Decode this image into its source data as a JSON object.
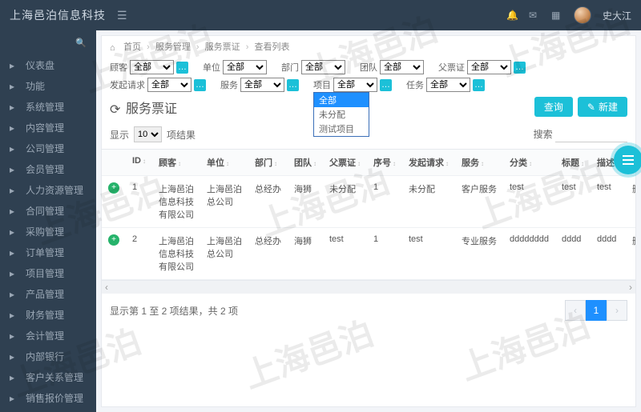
{
  "brand": "上海邑泊信息科技",
  "user": {
    "name": "史大江"
  },
  "watermark": "上海邑泊",
  "sidebar": {
    "items": [
      {
        "icon": "dashboard",
        "label": "仪表盘"
      },
      {
        "icon": "gear",
        "label": "功能"
      },
      {
        "icon": "cog",
        "label": "系统管理"
      },
      {
        "icon": "doc",
        "label": "内容管理"
      },
      {
        "icon": "building",
        "label": "公司管理"
      },
      {
        "icon": "users",
        "label": "会员管理"
      },
      {
        "icon": "hr",
        "label": "人力资源管理"
      },
      {
        "icon": "contract",
        "label": "合同管理"
      },
      {
        "icon": "cart",
        "label": "采购管理"
      },
      {
        "icon": "order",
        "label": "订单管理"
      },
      {
        "icon": "project",
        "label": "项目管理"
      },
      {
        "icon": "product",
        "label": "产品管理"
      },
      {
        "icon": "finance",
        "label": "财务管理"
      },
      {
        "icon": "account",
        "label": "会计管理"
      },
      {
        "icon": "bank",
        "label": "内部银行"
      },
      {
        "icon": "crm",
        "label": "客户关系管理"
      },
      {
        "icon": "quote",
        "label": "销售报价管理"
      }
    ]
  },
  "breadcrumb": {
    "home": "首页",
    "parts": [
      "服务管理",
      "服务票证",
      "查看列表"
    ]
  },
  "filters": {
    "row1": [
      {
        "label": "顾客",
        "value": "全部",
        "plus": true
      },
      {
        "label": "单位",
        "value": "全部",
        "plus": false
      },
      {
        "label": "部门",
        "value": "全部",
        "plus": false
      },
      {
        "label": "团队",
        "value": "全部",
        "plus": false
      },
      {
        "label": "父票证",
        "value": "全部",
        "plus": true
      }
    ],
    "row2": [
      {
        "label": "发起请求",
        "value": "全部",
        "plus": true
      },
      {
        "label": "服务",
        "value": "全部",
        "plus": true
      },
      {
        "label": "项目",
        "value": "全部",
        "plus": true,
        "open": true,
        "options": [
          "全部",
          "未分配",
          "测试项目"
        ],
        "selected": "全部"
      },
      {
        "label": "任务",
        "value": "全部",
        "plus": true
      }
    ]
  },
  "page": {
    "title": "服务票证",
    "btn_query": "查询",
    "btn_new": "新建",
    "show_label_left": "显示",
    "show_label_right": "项结果",
    "page_size": "10",
    "search_label": "搜索"
  },
  "table": {
    "columns": [
      "",
      "ID",
      "顾客",
      "单位",
      "部门",
      "团队",
      "父票证",
      "序号",
      "发起请求",
      "服务",
      "分类",
      "标题",
      "描述",
      ""
    ],
    "rows": [
      {
        "expand": true,
        "id": "1",
        "customer": "上海邑泊信息科技有限公司",
        "unit": "上海邑泊总公司",
        "dept": "总经办",
        "team": "海狮",
        "parent": "未分配",
        "seq": "1",
        "request": "未分配",
        "service": "客户服务",
        "category": "test",
        "title": "test",
        "desc": "test",
        "tail": "删"
      },
      {
        "expand": true,
        "id": "2",
        "customer": "上海邑泊信息科技有限公司",
        "unit": "上海邑泊总公司",
        "dept": "总经办",
        "team": "海狮",
        "parent": "test",
        "seq": "1",
        "request": "test",
        "service": "专业服务",
        "category": "dddddddd",
        "title": "dddd",
        "desc": "dddd",
        "tail": "删"
      }
    ]
  },
  "footer": {
    "summary": "显示第 1 至 2 项结果，共 2 项",
    "pages": [
      "‹",
      "1",
      "›"
    ],
    "active": "1"
  }
}
